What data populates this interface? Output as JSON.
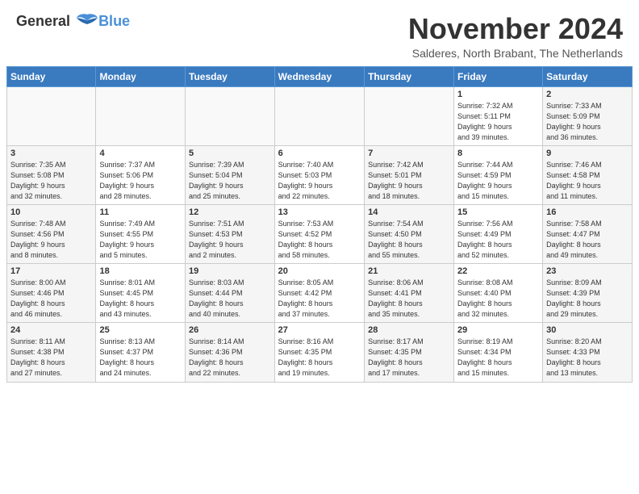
{
  "header": {
    "logo_line1": "General",
    "logo_line2": "Blue",
    "month_title": "November 2024",
    "subtitle": "Salderes, North Brabant, The Netherlands"
  },
  "weekdays": [
    "Sunday",
    "Monday",
    "Tuesday",
    "Wednesday",
    "Thursday",
    "Friday",
    "Saturday"
  ],
  "weeks": [
    [
      {
        "day": "",
        "content": ""
      },
      {
        "day": "",
        "content": ""
      },
      {
        "day": "",
        "content": ""
      },
      {
        "day": "",
        "content": ""
      },
      {
        "day": "",
        "content": ""
      },
      {
        "day": "1",
        "content": "Sunrise: 7:32 AM\nSunset: 5:11 PM\nDaylight: 9 hours\nand 39 minutes."
      },
      {
        "day": "2",
        "content": "Sunrise: 7:33 AM\nSunset: 5:09 PM\nDaylight: 9 hours\nand 36 minutes."
      }
    ],
    [
      {
        "day": "3",
        "content": "Sunrise: 7:35 AM\nSunset: 5:08 PM\nDaylight: 9 hours\nand 32 minutes."
      },
      {
        "day": "4",
        "content": "Sunrise: 7:37 AM\nSunset: 5:06 PM\nDaylight: 9 hours\nand 28 minutes."
      },
      {
        "day": "5",
        "content": "Sunrise: 7:39 AM\nSunset: 5:04 PM\nDaylight: 9 hours\nand 25 minutes."
      },
      {
        "day": "6",
        "content": "Sunrise: 7:40 AM\nSunset: 5:03 PM\nDaylight: 9 hours\nand 22 minutes."
      },
      {
        "day": "7",
        "content": "Sunrise: 7:42 AM\nSunset: 5:01 PM\nDaylight: 9 hours\nand 18 minutes."
      },
      {
        "day": "8",
        "content": "Sunrise: 7:44 AM\nSunset: 4:59 PM\nDaylight: 9 hours\nand 15 minutes."
      },
      {
        "day": "9",
        "content": "Sunrise: 7:46 AM\nSunset: 4:58 PM\nDaylight: 9 hours\nand 11 minutes."
      }
    ],
    [
      {
        "day": "10",
        "content": "Sunrise: 7:48 AM\nSunset: 4:56 PM\nDaylight: 9 hours\nand 8 minutes."
      },
      {
        "day": "11",
        "content": "Sunrise: 7:49 AM\nSunset: 4:55 PM\nDaylight: 9 hours\nand 5 minutes."
      },
      {
        "day": "12",
        "content": "Sunrise: 7:51 AM\nSunset: 4:53 PM\nDaylight: 9 hours\nand 2 minutes."
      },
      {
        "day": "13",
        "content": "Sunrise: 7:53 AM\nSunset: 4:52 PM\nDaylight: 8 hours\nand 58 minutes."
      },
      {
        "day": "14",
        "content": "Sunrise: 7:54 AM\nSunset: 4:50 PM\nDaylight: 8 hours\nand 55 minutes."
      },
      {
        "day": "15",
        "content": "Sunrise: 7:56 AM\nSunset: 4:49 PM\nDaylight: 8 hours\nand 52 minutes."
      },
      {
        "day": "16",
        "content": "Sunrise: 7:58 AM\nSunset: 4:47 PM\nDaylight: 8 hours\nand 49 minutes."
      }
    ],
    [
      {
        "day": "17",
        "content": "Sunrise: 8:00 AM\nSunset: 4:46 PM\nDaylight: 8 hours\nand 46 minutes."
      },
      {
        "day": "18",
        "content": "Sunrise: 8:01 AM\nSunset: 4:45 PM\nDaylight: 8 hours\nand 43 minutes."
      },
      {
        "day": "19",
        "content": "Sunrise: 8:03 AM\nSunset: 4:44 PM\nDaylight: 8 hours\nand 40 minutes."
      },
      {
        "day": "20",
        "content": "Sunrise: 8:05 AM\nSunset: 4:42 PM\nDaylight: 8 hours\nand 37 minutes."
      },
      {
        "day": "21",
        "content": "Sunrise: 8:06 AM\nSunset: 4:41 PM\nDaylight: 8 hours\nand 35 minutes."
      },
      {
        "day": "22",
        "content": "Sunrise: 8:08 AM\nSunset: 4:40 PM\nDaylight: 8 hours\nand 32 minutes."
      },
      {
        "day": "23",
        "content": "Sunrise: 8:09 AM\nSunset: 4:39 PM\nDaylight: 8 hours\nand 29 minutes."
      }
    ],
    [
      {
        "day": "24",
        "content": "Sunrise: 8:11 AM\nSunset: 4:38 PM\nDaylight: 8 hours\nand 27 minutes."
      },
      {
        "day": "25",
        "content": "Sunrise: 8:13 AM\nSunset: 4:37 PM\nDaylight: 8 hours\nand 24 minutes."
      },
      {
        "day": "26",
        "content": "Sunrise: 8:14 AM\nSunset: 4:36 PM\nDaylight: 8 hours\nand 22 minutes."
      },
      {
        "day": "27",
        "content": "Sunrise: 8:16 AM\nSunset: 4:35 PM\nDaylight: 8 hours\nand 19 minutes."
      },
      {
        "day": "28",
        "content": "Sunrise: 8:17 AM\nSunset: 4:35 PM\nDaylight: 8 hours\nand 17 minutes."
      },
      {
        "day": "29",
        "content": "Sunrise: 8:19 AM\nSunset: 4:34 PM\nDaylight: 8 hours\nand 15 minutes."
      },
      {
        "day": "30",
        "content": "Sunrise: 8:20 AM\nSunset: 4:33 PM\nDaylight: 8 hours\nand 13 minutes."
      }
    ]
  ]
}
